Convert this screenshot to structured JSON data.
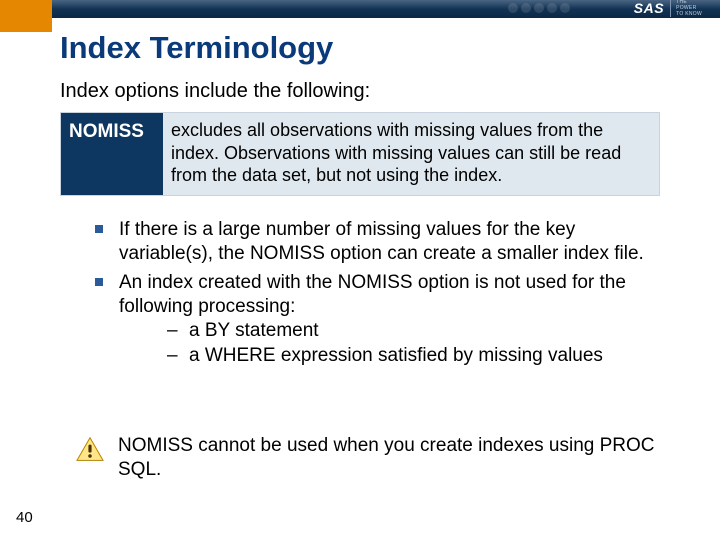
{
  "header": {
    "logo_brand": "SAS",
    "logo_tag_line1": "THE",
    "logo_tag_line2": "POWER",
    "logo_tag_line3": "TO KNOW"
  },
  "title": "Index Terminology",
  "subtitle": "Index options include the following:",
  "definition": {
    "term": "NOMISS",
    "desc": "excludes all observations with missing values from the index. Observations with missing values can still be read from the data set, but not using the index."
  },
  "bullets": [
    {
      "text": "If there is a large number of missing values for the key variable(s), the NOMISS option can create a smaller index file."
    },
    {
      "text": "An index created with the NOMISS option is not used for the following processing:",
      "sub": [
        "a BY statement",
        "a WHERE expression satisfied by missing values"
      ]
    }
  ],
  "warning": "NOMISS cannot be used when you create indexes using PROC SQL.",
  "page_number": "40"
}
